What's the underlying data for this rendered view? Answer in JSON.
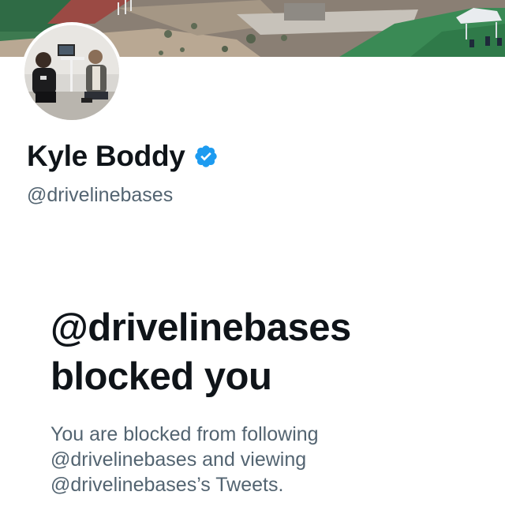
{
  "profile": {
    "display_name": "Kyle Boddy",
    "handle": "@drivelinebases",
    "verified": true,
    "verified_icon": "verified-badge-icon",
    "verified_color": "#1d9bf0"
  },
  "blocked_notice": {
    "title_line1": "@drivelinebases",
    "title_line2": "blocked you",
    "desc_line1": "You are blocked from following",
    "desc_line2": "@drivelinebases and viewing",
    "desc_line3": "@drivelinebases’s Tweets."
  },
  "colors": {
    "text_primary": "#0f1419",
    "text_secondary": "#536471",
    "accent": "#1d9bf0"
  }
}
